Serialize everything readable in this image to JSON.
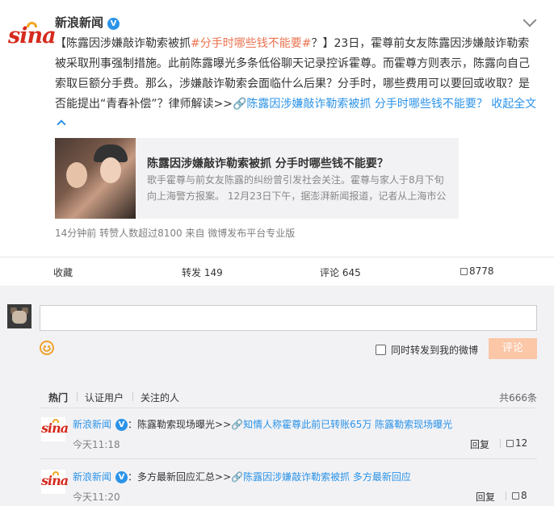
{
  "post": {
    "author": "新浪新闻",
    "verified_badge": "V",
    "text_segments": [
      {
        "text": "【陈露因涉嫌敲诈勒索被抓",
        "style": "plain"
      },
      {
        "text": "#分手时哪些钱不能要#",
        "style": "link"
      },
      {
        "text": "？】23日，霍尊前女友陈露因涉嫌敲诈勒索被采取刑事强制措施。此前陈露曝光多条低俗聊天记录控诉霍尊。而霍尊方则表示，陈露向自己索取巨额分手费。那么，涉嫌敲诈勒索会面临什么后果？分手时，哪些费用可以要回或收取？是否能提出“青春补偿”？律师解读>>",
        "style": "plain"
      },
      {
        "text": "🔗陈露因涉嫌敲诈勒索被抓 分手时哪些钱不能要？",
        "style": "blue"
      },
      {
        "text": "  收起全文",
        "style": "blue"
      }
    ],
    "meta": "14分钟前 转赞人数超过8100 来自 微博发布平台专业版"
  },
  "article": {
    "title": "陈露因涉嫌敲诈勒索被抓 分手时哪些钱不能要？",
    "description": "歌手霍尊与前女友陈露的纠纷曾引发社会关注。霍尊与家人于8月下旬向上海警方报案。 12月23日下午，据澎湃新闻报道，记者从上海市公"
  },
  "actions": {
    "favorite": "收藏",
    "repost": "转发 149",
    "comment": "评论 645",
    "like": "8778"
  },
  "composer": {
    "placeholder": "",
    "forward_label": "同时转发到我的微博",
    "submit_label": "评论"
  },
  "comment_tabs": {
    "tabs": [
      "热门",
      "认证用户",
      "关注的人"
    ],
    "total": "共666条"
  },
  "comments": [
    {
      "author": "新浪新闻",
      "text": "：陈露勒索现场曝光>>",
      "link": "🔗知情人称霍尊此前已转账65万 陈露勒索现场曝光",
      "time": "今天11:18",
      "reply": "回复",
      "likes": "12"
    },
    {
      "author": "新浪新闻",
      "text": "：多方最新回应汇总>>",
      "link": "🔗陈露因涉嫌敲诈勒索被抓 多方最新回应",
      "time": "今天11:20",
      "reply": "回复",
      "likes": "8"
    }
  ],
  "colors": {
    "accent_orange": "#eb7350",
    "link_blue": "#2b93e8",
    "submit_disabled": "#fbc7a7",
    "panel_bg": "#f2f2f5"
  }
}
